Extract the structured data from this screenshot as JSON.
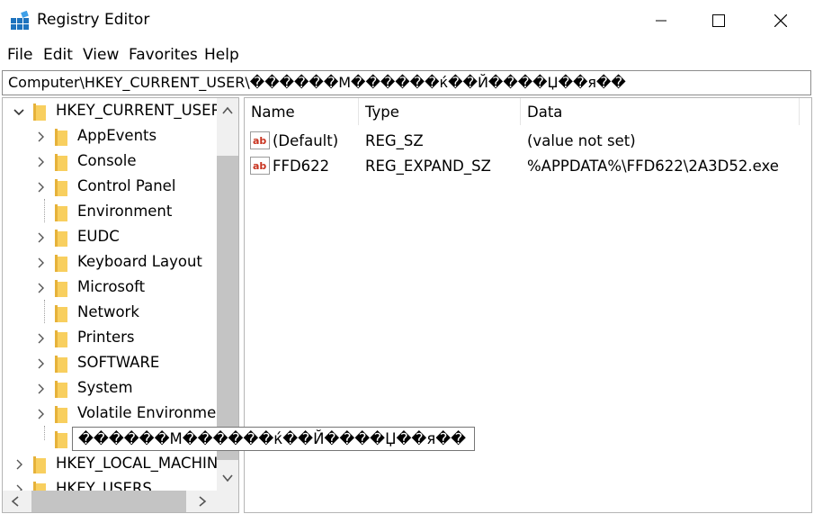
{
  "window": {
    "title": "Registry Editor",
    "minimize_icon": "minimize-icon",
    "maximize_icon": "maximize-icon",
    "close_icon": "close-icon"
  },
  "menu": [
    "File",
    "Edit",
    "View",
    "Favorites",
    "Help"
  ],
  "address": "Computer\\HKEY_CURRENT_USER\\������M������ќ��Й����Џ��я��",
  "tree": {
    "root": "HKEY_CURRENT_USER",
    "children": [
      "AppEvents",
      "Console",
      "Control Panel",
      "Environment",
      "EUDC",
      "Keyboard Layout",
      "Microsoft",
      "Network",
      "Printers",
      "SOFTWARE",
      "System",
      "Volatile Environment"
    ],
    "selected_tooltip": "������M������ќ��Й����Џ��я��",
    "siblings": [
      "HKEY_LOCAL_MACHINE",
      "HKEY_USERS"
    ]
  },
  "columns": [
    "Name",
    "Type",
    "Data"
  ],
  "values": [
    {
      "name": "(Default)",
      "type": "REG_SZ",
      "data": "(value not set)"
    },
    {
      "name": "FFD622",
      "type": "REG_EXPAND_SZ",
      "data": "%APPDATA%\\FFD622\\2A3D52.exe"
    }
  ],
  "colors": {
    "folder": "#f8cf5f",
    "chevron": "#5a5a5a",
    "accent": "#0078d7"
  }
}
